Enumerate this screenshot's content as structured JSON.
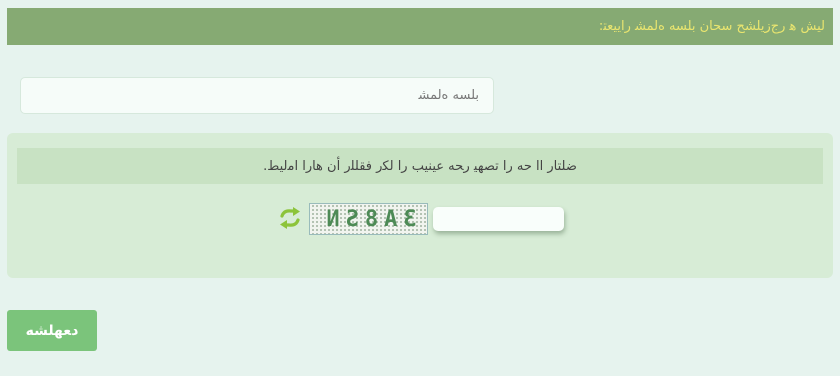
{
  "header": {
    "title": "ﻟﯿﺶ ﻫ ﺭﺝﺯ‌ﻳﻠﺸﺢ ﺳﺤﺎﻥ ﺑﻠﺴﻪ ﻩﻟﻤﺸ ﺭﺍﻳﻴﻌﺘ:"
  },
  "name_field": {
    "placeholder": "ﺑﻠﺴﻪ ﻩﻟﻤﺸ",
    "value": ""
  },
  "captcha": {
    "instruction": "ﺿﻠﺘﺎﺭ ﺍﺍ ﺣﻪ ﺭﺍ ﺗﺼﻬﻴ ﺭﺤﻪ ﻋﯿﻨﯿﺐ ﺭﺍ ﻟﻜﺭ ﻓﻘﻠﻠﺭ ﺃﻥ ﻫﺎﺭﺍ ﺍﻣﻟﻴﻂ.",
    "code": "3A8SN",
    "refresh_icon": "refresh-icon",
    "input_value": ""
  },
  "submit": {
    "label": "ﺩﻌﻬﻠﺸﻪ"
  },
  "colors": {
    "header_bg": "#86aa73",
    "header_text": "#e9e56f",
    "page_bg": "#e6f3ee",
    "panel_bg": "#d7ecd6",
    "note_bg": "#c8e2c3",
    "button_bg": "#7bc47b"
  }
}
